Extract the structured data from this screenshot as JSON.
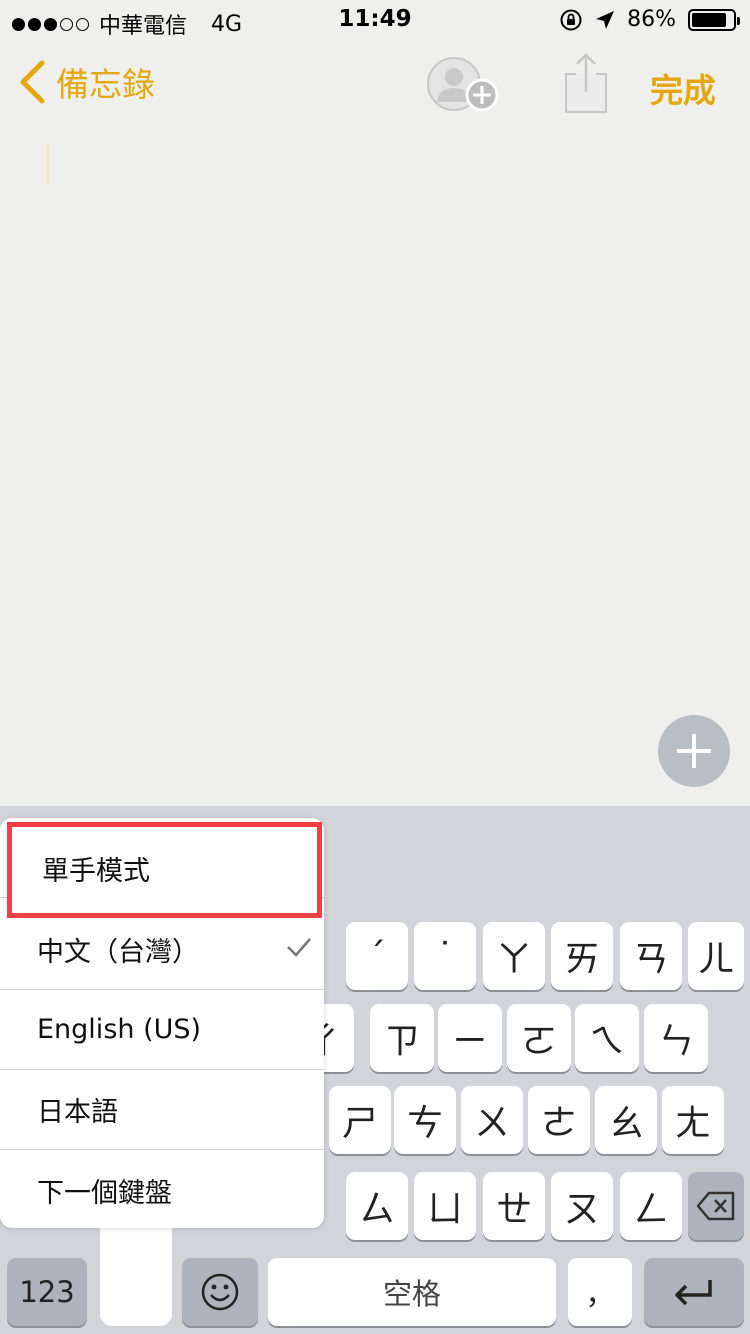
{
  "status_bar": {
    "carrier": "中華電信",
    "network": "4G",
    "time": "11:49",
    "battery": "86%",
    "battery_level": 0.86
  },
  "nav": {
    "back_label": "備忘錄",
    "done_label": "完成",
    "accent_color": "#e5a70f"
  },
  "keyboard_menu": {
    "items": [
      {
        "label": "單手模式",
        "highlighted": true
      },
      {
        "label": "中文（台灣）",
        "checked": true
      },
      {
        "label": "English (US)"
      },
      {
        "label": "日本語"
      },
      {
        "label": "下一個鍵盤"
      }
    ]
  },
  "keyboard": {
    "row1": [
      "ˊ",
      "˙",
      "ㄚ",
      "ㄞ",
      "ㄢ",
      "ㄦ"
    ],
    "row2": [
      "ㄔ",
      "ㄗ",
      "ㄧ",
      "ㄛ",
      "ㄟ",
      "ㄣ"
    ],
    "row3": [
      "ㄕ",
      "ㄘ",
      "ㄨ",
      "ㄜ",
      "ㄠ",
      "ㄤ"
    ],
    "row4": [
      "ㄙ",
      "ㄩ",
      "ㄝ",
      "ㄡ",
      "ㄥ"
    ],
    "numbers_label": "123",
    "space_label": "空格",
    "comma_label": "，"
  }
}
